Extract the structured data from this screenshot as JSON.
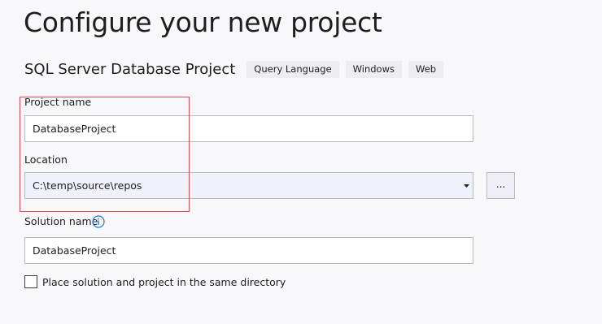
{
  "header": {
    "title": "Configure your new project"
  },
  "project_type": {
    "name": "SQL Server Database Project",
    "tags": [
      "Query Language",
      "Windows",
      "Web"
    ]
  },
  "project_name": {
    "label": "Project name",
    "value": "DatabaseProject"
  },
  "location": {
    "label": "Location",
    "value": "C:\\temp\\source\\repos",
    "browse_label": "..."
  },
  "solution_name": {
    "label": "Solution name",
    "value": "DatabaseProject",
    "info_icon": "info-icon"
  },
  "same_directory": {
    "label": "Place solution and project in the same directory",
    "checked": false
  },
  "colors": {
    "highlight": "#e0484d",
    "info_icon": "#1e7bd0",
    "background": "#f8f8fb"
  }
}
